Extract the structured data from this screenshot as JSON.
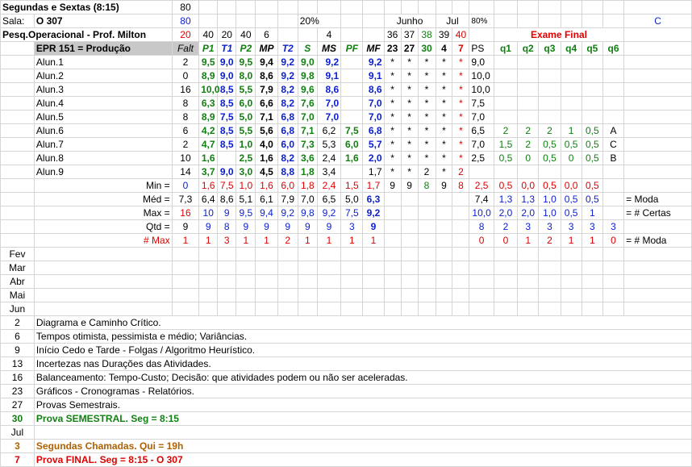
{
  "header": {
    "title": "Segundas e Sextas (8:15)",
    "title_value": "80",
    "room_label": "Sala:",
    "room": "O 307",
    "room_value": "80",
    "pct": "20%",
    "course": "Pesq.Operacional - Prof. Milton",
    "course_value": "20",
    "weights": [
      "40",
      "20",
      "40",
      "6",
      "",
      "",
      "4"
    ],
    "month_june": "Junho",
    "month_july": "Jul",
    "pct80": "80%",
    "col_c": "C",
    "days": [
      "36",
      "37",
      "38",
      "39",
      "40"
    ],
    "exam_final": "Exame Final"
  },
  "columns": {
    "course_code": "EPR 151 = Produção",
    "faltas": "Falt",
    "grades": [
      "P1",
      "T1",
      "P2",
      "MP",
      "T2",
      "S",
      "MS",
      "PF",
      "MF"
    ],
    "june_days": [
      "23",
      "27",
      "30",
      "4",
      "7"
    ],
    "ps": "PS",
    "questions": [
      "q1",
      "q2",
      "q3",
      "q4",
      "q5",
      "q6"
    ]
  },
  "students": [
    {
      "name": "Alun.1",
      "falt": "2",
      "g": [
        "9,5",
        "9,0",
        "9,5",
        "9,4",
        "9,2",
        "9,0",
        "9,2",
        "",
        "9,2"
      ],
      "d": [
        "*",
        "*",
        "*",
        "*",
        "*"
      ],
      "ps": "9,0",
      "q": [
        "",
        "",
        "",
        "",
        "",
        ""
      ]
    },
    {
      "name": "Alun.2",
      "falt": "0",
      "g": [
        "8,9",
        "9,0",
        "8,0",
        "8,6",
        "9,2",
        "9,8",
        "9,1",
        "",
        "9,1"
      ],
      "d": [
        "*",
        "*",
        "*",
        "*",
        "*"
      ],
      "ps": "10,0",
      "q": [
        "",
        "",
        "",
        "",
        "",
        ""
      ]
    },
    {
      "name": "Alun.3",
      "falt": "16",
      "g": [
        "10,0",
        "8,5",
        "5,5",
        "7,9",
        "8,2",
        "9,6",
        "8,6",
        "",
        "8,6"
      ],
      "d": [
        "*",
        "*",
        "*",
        "*",
        "*"
      ],
      "ps": "10,0",
      "q": [
        "",
        "",
        "",
        "",
        "",
        ""
      ]
    },
    {
      "name": "Alun.4",
      "falt": "8",
      "g": [
        "6,3",
        "8,5",
        "6,0",
        "6,6",
        "8,2",
        "7,6",
        "7,0",
        "",
        "7,0"
      ],
      "d": [
        "*",
        "*",
        "*",
        "*",
        "*"
      ],
      "ps": "7,5",
      "q": [
        "",
        "",
        "",
        "",
        "",
        ""
      ]
    },
    {
      "name": "Alun.5",
      "falt": "8",
      "g": [
        "8,9",
        "7,5",
        "5,0",
        "7,1",
        "6,8",
        "7,0",
        "7,0",
        "",
        "7,0"
      ],
      "d": [
        "*",
        "*",
        "*",
        "*",
        "*"
      ],
      "ps": "7,0",
      "q": [
        "",
        "",
        "",
        "",
        "",
        ""
      ]
    },
    {
      "name": "Alun.6",
      "falt": "6",
      "g": [
        "4,2",
        "8,5",
        "5,5",
        "5,6",
        "6,8",
        "7,1",
        "6,2",
        "7,5",
        "6,8"
      ],
      "d": [
        "*",
        "*",
        "*",
        "*",
        "*"
      ],
      "ps": "6,5",
      "q": [
        "2",
        "2",
        "2",
        "1",
        "0,5",
        "A"
      ]
    },
    {
      "name": "Alun.7",
      "falt": "2",
      "g": [
        "4,7",
        "8,5",
        "1,0",
        "4,0",
        "6,0",
        "7,3",
        "5,3",
        "6,0",
        "5,7"
      ],
      "d": [
        "*",
        "*",
        "*",
        "*",
        "*"
      ],
      "ps": "7,0",
      "q": [
        "1,5",
        "2",
        "0,5",
        "0,5",
        "0,5",
        "C"
      ]
    },
    {
      "name": "Alun.8",
      "falt": "10",
      "g": [
        "1,6",
        "",
        "2,5",
        "1,6",
        "8,2",
        "3,6",
        "2,4",
        "1,6",
        "2,0"
      ],
      "d": [
        "*",
        "*",
        "*",
        "*",
        "*"
      ],
      "ps": "2,5",
      "q": [
        "0,5",
        "0",
        "0,5",
        "0",
        "0,5",
        "B"
      ]
    },
    {
      "name": "Alun.9",
      "falt": "14",
      "g": [
        "3,7",
        "9,0",
        "3,0",
        "4,5",
        "8,8",
        "1,8",
        "3,4",
        "",
        "1,7"
      ],
      "d": [
        "*",
        "*",
        "2",
        "*",
        "2"
      ],
      "ps": "",
      "q": [
        "",
        "",
        "",
        "",
        "",
        ""
      ]
    }
  ],
  "stats": {
    "min": {
      "label": "Min =",
      "v": [
        "0",
        "1,6",
        "7,5",
        "1,0",
        "1,6",
        "6,0",
        "1,8",
        "2,4",
        "1,5",
        "1,7"
      ],
      "d": [
        "9",
        "9",
        "8",
        "9",
        "8"
      ],
      "ps": "2,5",
      "q": [
        "0,5",
        "0,0",
        "0,5",
        "0,0",
        "0,5"
      ],
      "note": ""
    },
    "med": {
      "label": "Méd =",
      "v": [
        "7,3",
        "6,4",
        "8,6",
        "5,1",
        "6,1",
        "7,9",
        "7,0",
        "6,5",
        "5,0",
        "6,3"
      ],
      "d": [
        "",
        "",
        "",
        "",
        ""
      ],
      "ps": "7,4",
      "q": [
        "1,3",
        "1,3",
        "1,0",
        "0,5",
        "0,5"
      ],
      "note": "= Moda"
    },
    "max": {
      "label": "Max =",
      "v": [
        "16",
        "10",
        "9",
        "9,5",
        "9,4",
        "9,2",
        "9,8",
        "9,2",
        "7,5",
        "9,2"
      ],
      "d": [
        "",
        "",
        "",
        "",
        ""
      ],
      "ps": "10,0",
      "q": [
        "2,0",
        "2,0",
        "1,0",
        "0,5",
        "1"
      ],
      "note": "= # Certas"
    },
    "qtd": {
      "label": "Qtd =",
      "v": [
        "9",
        "9",
        "8",
        "9",
        "9",
        "9",
        "9",
        "9",
        "3",
        "9"
      ],
      "d": [
        "",
        "",
        "",
        "",
        ""
      ],
      "ps": "8",
      "q": [
        "2",
        "3",
        "3",
        "3",
        "3",
        "3"
      ],
      "note": ""
    },
    "nmax": {
      "label": "# Max",
      "v": [
        "1",
        "1",
        "3",
        "1",
        "1",
        "2",
        "1",
        "1",
        "1",
        "1"
      ],
      "d": [
        "",
        "",
        "",
        "",
        ""
      ],
      "ps": "0",
      "q": [
        "0",
        "1",
        "2",
        "1",
        "1",
        "0"
      ],
      "note": "= # Moda"
    }
  },
  "calendar": {
    "months": [
      "Fev",
      "Mar",
      "Abr",
      "Mai",
      "Jun"
    ],
    "entries": [
      {
        "day": "2",
        "text": "Diagrama e Caminho Crítico."
      },
      {
        "day": "6",
        "text": "Tempos otimista, pessimista e médio; Variâncias."
      },
      {
        "day": "9",
        "text": "Início Cedo e Tarde - Folgas / Algoritmo Heurístico."
      },
      {
        "day": "13",
        "text": "Incertezas nas Durações das Atividades."
      },
      {
        "day": "16",
        "text": "Balanceamento: Tempo-Custo; Decisão: que atividades podem ou não ser aceleradas."
      },
      {
        "day": "23",
        "text": "Gráficos - Cronogramas - Relatórios."
      },
      {
        "day": "27",
        "text": "Provas Semestrais."
      },
      {
        "day": "30",
        "text": "Prova SEMESTRAL. Seg = 8:15"
      },
      {
        "day": "Jul",
        "text": ""
      },
      {
        "day": "3",
        "text": "Segundas Chamadas. Qui = 19h"
      },
      {
        "day": "7",
        "text": "Prova FINAL. Seg = 8:15 - O 307"
      }
    ]
  }
}
